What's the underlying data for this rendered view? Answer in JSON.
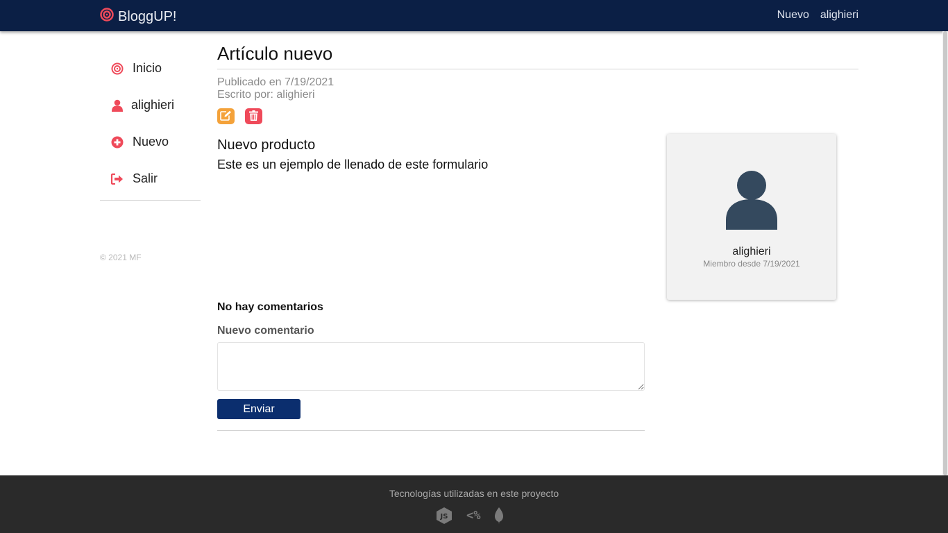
{
  "navbar": {
    "brand": "BloggUP!",
    "links": [
      "Nuevo",
      "alighieri"
    ]
  },
  "sidebar": {
    "items": [
      {
        "label": "Inicio",
        "icon": "target-icon"
      },
      {
        "label": "alighieri",
        "icon": "user-icon"
      },
      {
        "label": "Nuevo",
        "icon": "plus-circle-icon"
      },
      {
        "label": "Salir",
        "icon": "sign-out-icon"
      }
    ],
    "copyright": "© 2021 MF"
  },
  "article": {
    "title": "Artículo nuevo",
    "published": "Publicado en 7/19/2021",
    "author": "Escrito por: alighieri",
    "subtitle": "Nuevo producto",
    "body": "Este es un ejemplo de llenado de este formulario"
  },
  "comments": {
    "empty_text": "No hay comentarios",
    "new_label": "Nuevo comentario",
    "input_value": "",
    "submit_label": "Enviar"
  },
  "author_card": {
    "name": "alighieri",
    "member_since": "Miembro desde 7/19/2021"
  },
  "footer": {
    "text": "Tecnologías utilizadas en este proyecto",
    "icons": [
      "nodejs-icon",
      "ejs-icon",
      "mongodb-icon"
    ]
  },
  "colors": {
    "navbar_bg": "#0b1f45",
    "accent_red": "#ef4a5a",
    "edit_orange": "#f4a23a",
    "submit_blue": "#0b2e6e",
    "footer_bg": "#2a2a2a"
  }
}
